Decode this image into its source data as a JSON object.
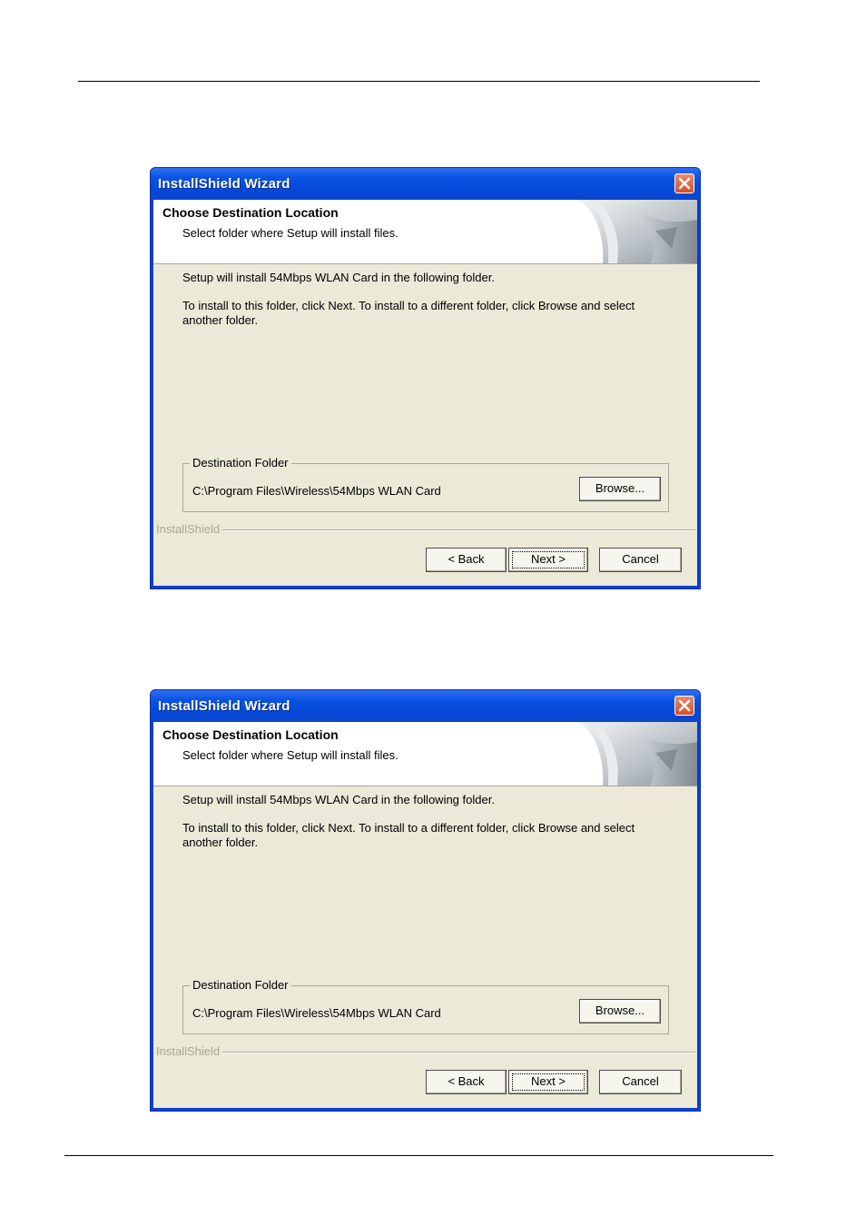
{
  "dialogs": [
    {
      "title": "InstallShield Wizard",
      "header_title": "Choose Destination Location",
      "header_subtitle": "Select folder where Setup will install files.",
      "info_line": "Setup will install 54Mbps WLAN Card in the following folder.",
      "instructions": "To install to this folder, click Next. To install to a different folder, click Browse and select another folder.",
      "group_label": "Destination Folder",
      "destination_path": "C:\\Program Files\\Wireless\\54Mbps WLAN Card",
      "browse_label": "Browse...",
      "brand_label": "InstallShield",
      "back_label": "< Back",
      "next_label": "Next >",
      "cancel_label": "Cancel"
    },
    {
      "title": "InstallShield Wizard",
      "header_title": "Choose Destination Location",
      "header_subtitle": "Select folder where Setup will install files.",
      "info_line": "Setup will install 54Mbps WLAN Card in the following folder.",
      "instructions": "To install to this folder, click Next. To install to a different folder, click Browse and select another folder.",
      "group_label": "Destination Folder",
      "destination_path": "C:\\Program Files\\Wireless\\54Mbps WLAN Card",
      "browse_label": "Browse...",
      "brand_label": "InstallShield",
      "back_label": "< Back",
      "next_label": "Next >",
      "cancel_label": "Cancel"
    }
  ],
  "colors": {
    "titlebar": "#0a54e3",
    "dialog_face": "#ece9d8",
    "close_button": "#d2502c"
  },
  "icons": [
    "close-icon",
    "installshield-header-graphic"
  ]
}
